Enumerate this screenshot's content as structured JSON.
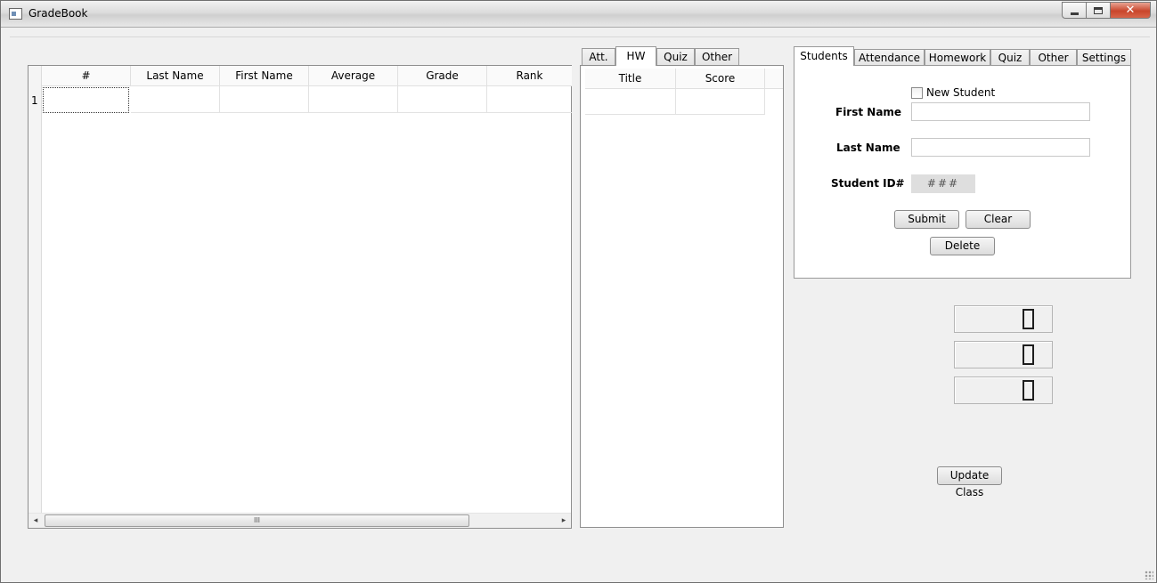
{
  "window": {
    "title": "GradeBook",
    "close_glyph": "✕"
  },
  "student_table": {
    "columns": [
      "#",
      "Last Name",
      "First Name",
      "Average",
      "Grade",
      "Rank"
    ],
    "row_numbers": [
      "1"
    ],
    "scroll_thumb_glyph": "III",
    "scroll_left_glyph": "◂",
    "scroll_right_glyph": "▸"
  },
  "detail_tabs": {
    "items": [
      "Att.",
      "HW",
      "Quiz",
      "Other"
    ],
    "active": "HW",
    "columns": [
      "Title",
      "Score"
    ]
  },
  "main_tabs": {
    "items": [
      "Students",
      "Attendance",
      "Homework",
      "Quiz",
      "Other",
      "Settings"
    ],
    "active": "Students"
  },
  "student_form": {
    "new_student_label": "New Student",
    "first_name_label": "First Name",
    "last_name_label": "Last Name",
    "student_id_label": "Student ID#",
    "student_id_value": "###",
    "first_name_value": "",
    "last_name_value": "",
    "submit_label": "Submit",
    "clear_label": "Clear",
    "delete_label": "Delete"
  },
  "counters": [
    "0",
    "0",
    "0"
  ],
  "update_button_label": "Update Class"
}
